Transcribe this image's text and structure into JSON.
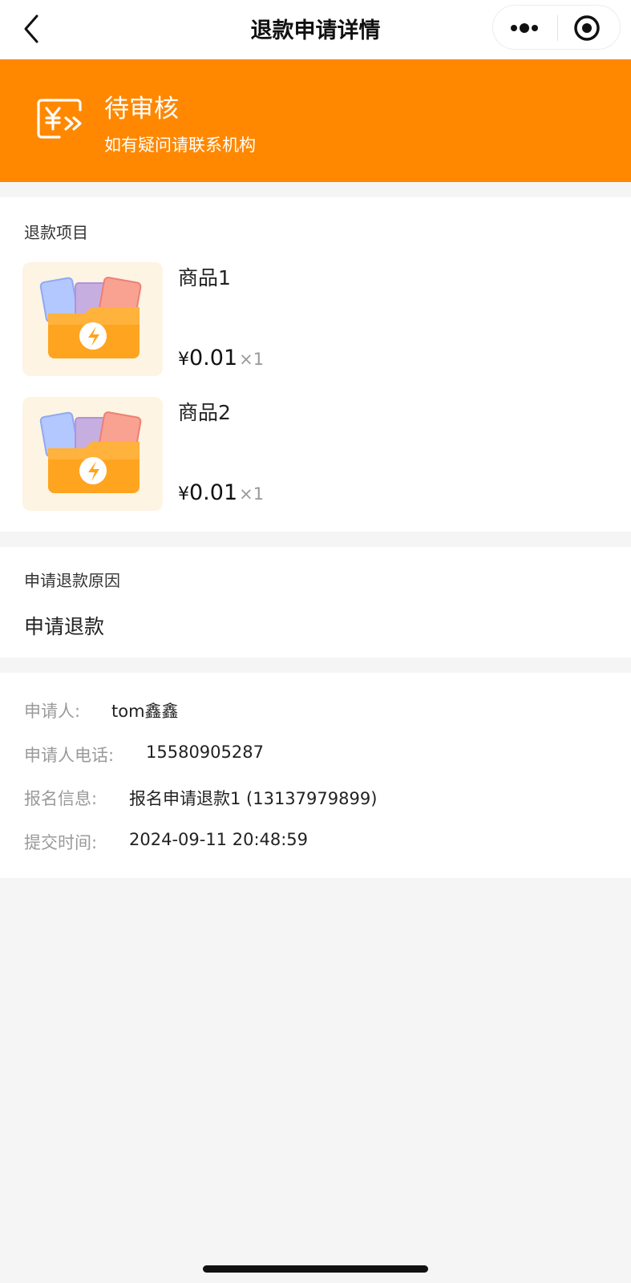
{
  "nav": {
    "title": "退款申请详情",
    "back_icon": "chevron-left-icon",
    "more_icon": "more-dots-icon",
    "close_icon": "target-close-icon"
  },
  "status": {
    "title": "待审核",
    "subtitle": "如有疑问请联系机构",
    "icon": "refund-yuan-icon",
    "color": "#ff8800"
  },
  "refund_items": {
    "label": "退款项目",
    "items": [
      {
        "name": "商品1",
        "currency": "¥",
        "price": "0.01",
        "qty": "×1"
      },
      {
        "name": "商品2",
        "currency": "¥",
        "price": "0.01",
        "qty": "×1"
      }
    ]
  },
  "reason": {
    "label": "申请退款原因",
    "text": "申请退款"
  },
  "info": {
    "applicant_label": "申请人:",
    "applicant": "tom鑫鑫",
    "phone_label": "申请人电话:",
    "phone": "15580905287",
    "signup_label": "报名信息:",
    "signup": "报名申请退款1 (13137979899)",
    "time_label": "提交时间:",
    "time": "2024-09-11 20:48:59"
  }
}
